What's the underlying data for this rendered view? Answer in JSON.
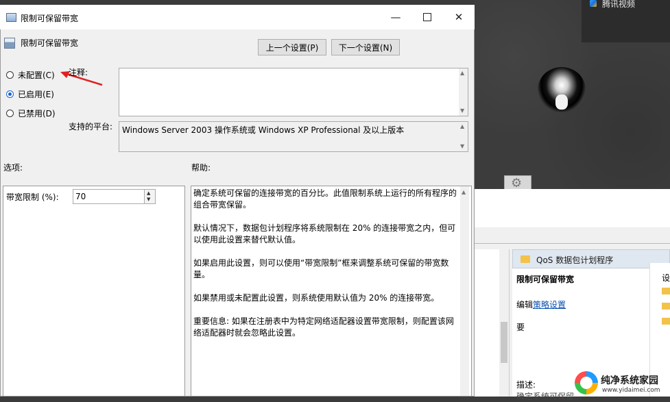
{
  "background": {
    "video_app_label": "腾讯视频",
    "editor": {
      "header": "QoS 数据包计划程序",
      "title": "限制可保留带宽",
      "edit_prefix": "编辑",
      "edit_link": "策略设置",
      "req_label": "要",
      "desc_label": "描述:",
      "desc_text": "确定系统可保留...",
      "right_col_head": "设"
    },
    "watermark": {
      "name": "纯净系统家园",
      "url": "www.yidaimei.com"
    }
  },
  "dialog": {
    "title": "限制可保留带宽",
    "heading": "限制可保留带宽",
    "buttons": {
      "prev": "上一个设置(P)",
      "next": "下一个设置(N)"
    },
    "radios": [
      {
        "label": "未配置(C)",
        "checked": false
      },
      {
        "label": "已启用(E)",
        "checked": true
      },
      {
        "label": "已禁用(D)",
        "checked": false
      }
    ],
    "comment_label": "注释:",
    "comment_value": "",
    "platform_label": "支持的平台:",
    "platform_value": "Windows Server 2003 操作系统或 Windows XP Professional 及以上版本",
    "options_label": "选项:",
    "help_label": "帮助:",
    "option": {
      "label": "带宽限制 (%):",
      "value": "70"
    },
    "help": [
      "确定系统可保留的连接带宽的百分比。此值限制系统上运行的所有程序的组合带宽保留。",
      "默认情况下，数据包计划程序将系统限制在 20% 的连接带宽之内，但可以使用此设置来替代默认值。",
      "如果启用此设置，则可以使用“带宽限制”框来调整系统可保留的带宽数量。",
      "如果禁用或未配置此设置，则系统使用默认值为 20% 的连接带宽。",
      "重要信息: 如果在注册表中为特定网络适配器设置带宽限制，则配置该网络适配器时就会忽略此设置。"
    ],
    "annotation_color": "#e02020"
  }
}
